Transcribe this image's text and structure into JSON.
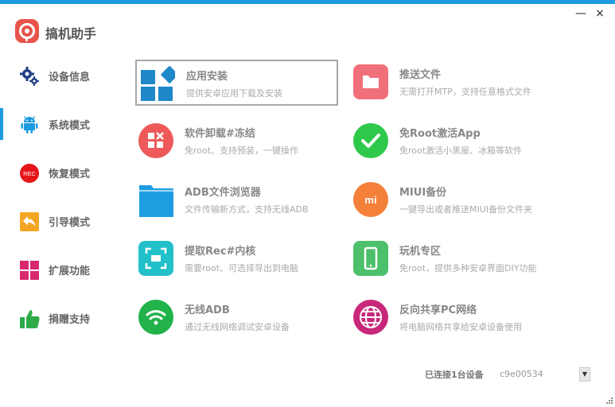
{
  "app": {
    "title": "搞机助手"
  },
  "window_controls": {
    "close": "×",
    "minimize": "—"
  },
  "sidebar": {
    "items": [
      {
        "label": "设备信息",
        "icon": "gears-icon",
        "active": false
      },
      {
        "label": "系统模式",
        "icon": "android-icon",
        "active": true
      },
      {
        "label": "恢复模式",
        "icon": "rec-icon",
        "icon_text": "REC",
        "active": false
      },
      {
        "label": "引导模式",
        "icon": "reply-arrow-icon",
        "active": false
      },
      {
        "label": "扩展功能",
        "icon": "grid-icon",
        "active": false
      },
      {
        "label": "捐赠支持",
        "icon": "thumbs-up-icon",
        "active": false
      }
    ]
  },
  "tiles": [
    {
      "title": "应用安装",
      "desc": "提供安卓应用下载及安装",
      "icon": "apps-install-icon",
      "color": "#1e88c8",
      "selected": true
    },
    {
      "title": "推送文件",
      "desc": "无需打开MTP，支持任意格式文件",
      "icon": "folder-icon",
      "color": "#f0707a",
      "selected": false
    },
    {
      "title": "软件卸载#冻结",
      "desc": "免root、支持预装，一键操作",
      "icon": "uninstall-icon",
      "color": "#ee5a5a",
      "selected": false
    },
    {
      "title": "免Root激活App",
      "desc": "免root激活小黑屋、冰箱等软件",
      "icon": "check-icon",
      "color": "#2ec84a",
      "selected": false
    },
    {
      "title": "ADB文件浏览器",
      "desc": "文件传输新方式，支持无线ADB",
      "icon": "adb-folder-icon",
      "color": "#1e9ee0",
      "selected": false
    },
    {
      "title": "MIUI备份",
      "desc": "一键导出或者推送MIUI备份文件夹",
      "icon": "mi-icon",
      "icon_text": "mi",
      "color": "#f5803a",
      "selected": false
    },
    {
      "title": "提取Rec#内核",
      "desc": "需要root、可选择导出到电脑",
      "icon": "extract-icon",
      "color": "#22c0c8",
      "selected": false
    },
    {
      "title": "玩机专区",
      "desc": "免root，提供多种安卓界面DIY功能",
      "icon": "phone-icon",
      "color": "#4cc06a",
      "selected": false
    },
    {
      "title": "无线ADB",
      "desc": "通过无线网络调试安卓设备",
      "icon": "wifi-icon",
      "color": "#22b24a",
      "selected": false
    },
    {
      "title": "反向共享PC网络",
      "desc": "将电脑网络共享给安卓设备使用",
      "icon": "globe-icon",
      "color": "#c8287a",
      "selected": false
    }
  ],
  "status": {
    "label": "已连接1台设备",
    "device": "c9e00534"
  },
  "colors": {
    "accent": "#1c9be0"
  }
}
